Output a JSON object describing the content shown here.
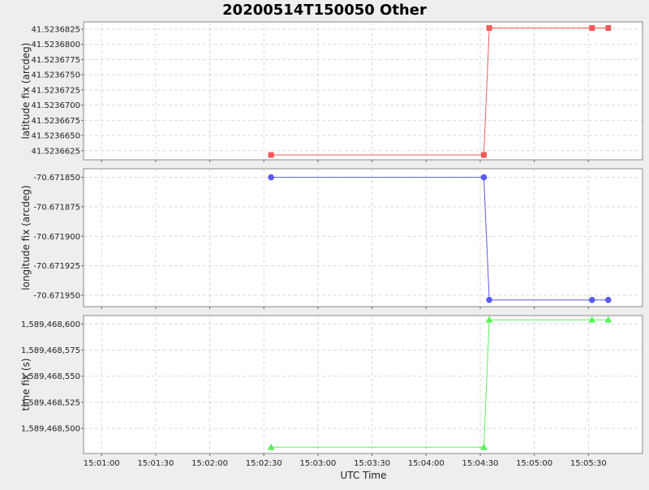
{
  "chart_data": {
    "type": "line",
    "title": "20200514T150050 Other",
    "xlabel": "UTC Time",
    "x_ticks": [
      "15:01:00",
      "15:01:30",
      "15:02:00",
      "15:02:30",
      "15:03:00",
      "15:03:30",
      "15:04:00",
      "15:04:30",
      "15:05:00",
      "15:05:30"
    ],
    "xlim": [
      "15:00:50",
      "15:06:00"
    ],
    "grid": true,
    "legend": "none",
    "x": [
      "15:02:34",
      "15:04:32",
      "15:04:35",
      "15:05:32",
      "15:05:41"
    ],
    "panels": [
      {
        "ylabel": "latitude fix (arcdeg)",
        "color": "#f05a5a",
        "marker": "square",
        "y_ticks": [
          "41.5236825",
          "41.5236800",
          "41.5236775",
          "41.5236750",
          "41.5236725",
          "41.5236700",
          "41.5236675",
          "41.5236650",
          "41.5236625"
        ],
        "y_tick_values": [
          41.5236825,
          41.52368,
          41.5236775,
          41.523675,
          41.5236725,
          41.52367,
          41.5236675,
          41.523665,
          41.5236625
        ],
        "ylim": [
          41.523661,
          41.5236837
        ],
        "values": [
          41.5236618,
          41.5236618,
          41.5236827,
          41.5236827,
          41.5236827
        ]
      },
      {
        "ylabel": "longitude fix (arcdeg)",
        "color": "#5a5af0",
        "marker": "circle",
        "y_ticks": [
          "-70.671850",
          "-70.671875",
          "-70.671900",
          "-70.671925",
          "-70.671950"
        ],
        "y_tick_values": [
          -70.67185,
          -70.671875,
          -70.6719,
          -70.671925,
          -70.67195
        ],
        "ylim": [
          -70.6719597,
          -70.6718427
        ],
        "values": [
          -70.67185,
          -70.67185,
          -70.671954,
          -70.671954,
          -70.671954
        ]
      },
      {
        "ylabel": "time fix (s)",
        "color": "#5af05a",
        "marker": "triangle",
        "y_ticks": [
          "1,589,468,600",
          "1,589,468,575",
          "1,589,468,550",
          "1,589,468,525",
          "1,589,468,500"
        ],
        "y_tick_values": [
          1589468600,
          1589468575,
          1589468550,
          1589468525,
          1589468500
        ],
        "ylim": [
          1589468476,
          1589468608
        ],
        "values": [
          1589468482,
          1589468482,
          1589468604,
          1589468604,
          1589468604
        ]
      }
    ]
  }
}
